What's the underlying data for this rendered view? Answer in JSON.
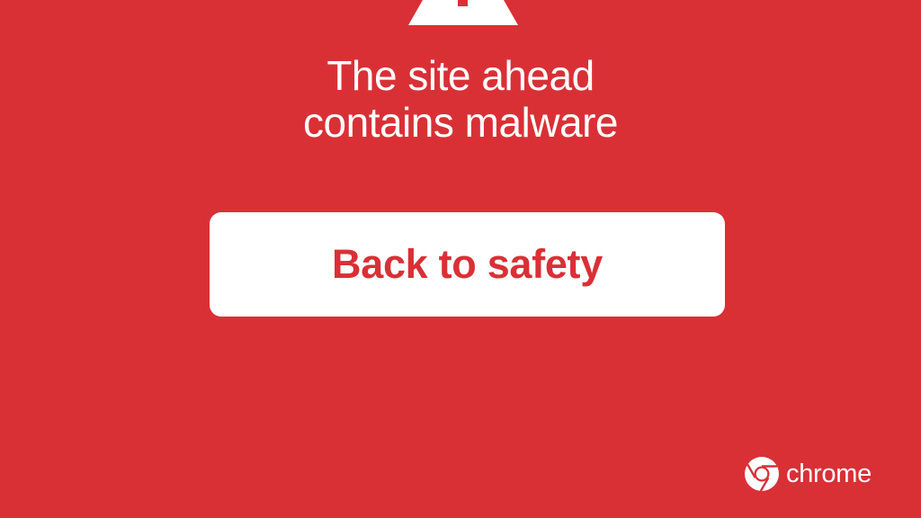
{
  "colors": {
    "background": "#d93036",
    "button_background": "#ffffff",
    "button_text": "#d93036",
    "text": "#ffffff"
  },
  "warning": {
    "icon": "warning-triangle-icon",
    "headline_line1": "The site ahead",
    "headline_line2": "contains malware"
  },
  "actions": {
    "back_label": "Back to safety"
  },
  "brand": {
    "icon": "chrome-logo-icon",
    "name": "chrome"
  }
}
